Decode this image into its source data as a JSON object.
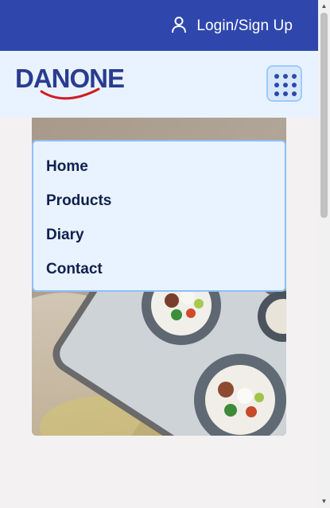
{
  "topbar": {
    "login_label": "Login/Sign Up",
    "login_icon": "user-icon",
    "background": "#2f47ad"
  },
  "header": {
    "logo_text": "DANONE",
    "menu_icon": "grid-dots-icon",
    "background": "#e8f3ff"
  },
  "nav_menu": {
    "items": [
      "Home",
      "Products",
      "Diary",
      "Contact"
    ]
  },
  "hero": {
    "image_description_icon": "food-bowls-photo"
  }
}
